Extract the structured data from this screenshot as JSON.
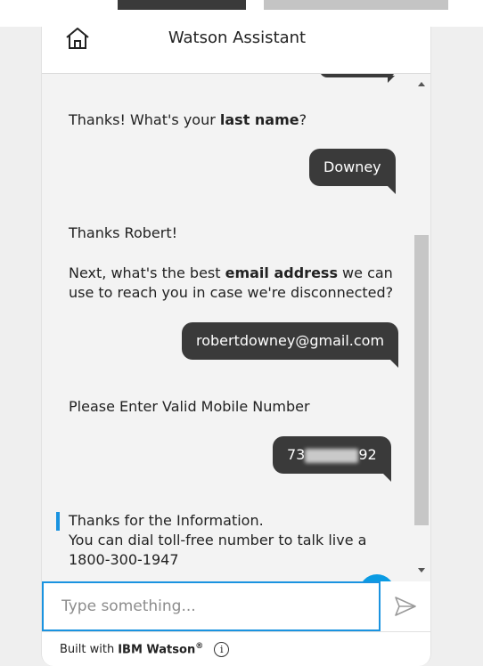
{
  "header": {
    "title": "Watson Assistant",
    "home_icon": "home-icon"
  },
  "messages": [
    {
      "from": "bot",
      "parts": [
        "Thanks! What's your ",
        "last name",
        "?"
      ]
    },
    {
      "from": "user",
      "text": "Downey"
    },
    {
      "from": "bot",
      "line1": "Thanks Robert!",
      "line2_parts": [
        "Next, what's the best ",
        "email address",
        " we can"
      ],
      "line3": "use to reach you in case we're disconnected?"
    },
    {
      "from": "user",
      "text": "robertdowney@gmail.com"
    },
    {
      "from": "bot",
      "text": "Please Enter Valid Mobile Number"
    },
    {
      "from": "user",
      "text_start": "73",
      "text_end": "92"
    },
    {
      "from": "bot",
      "line1": "Thanks for the Information.",
      "line2": "You can dial toll-free number to talk live a",
      "line3": "1800-300-1947"
    }
  ],
  "help_button": {
    "label": "?"
  },
  "input": {
    "placeholder": "Type something..."
  },
  "footer": {
    "built_with": "Built with",
    "brand": "IBM Watson",
    "trademark": "®",
    "info": "i"
  },
  "colors": {
    "accent": "#1a93e0",
    "bubble": "#3a3a3a",
    "help": "#0a9be3"
  }
}
